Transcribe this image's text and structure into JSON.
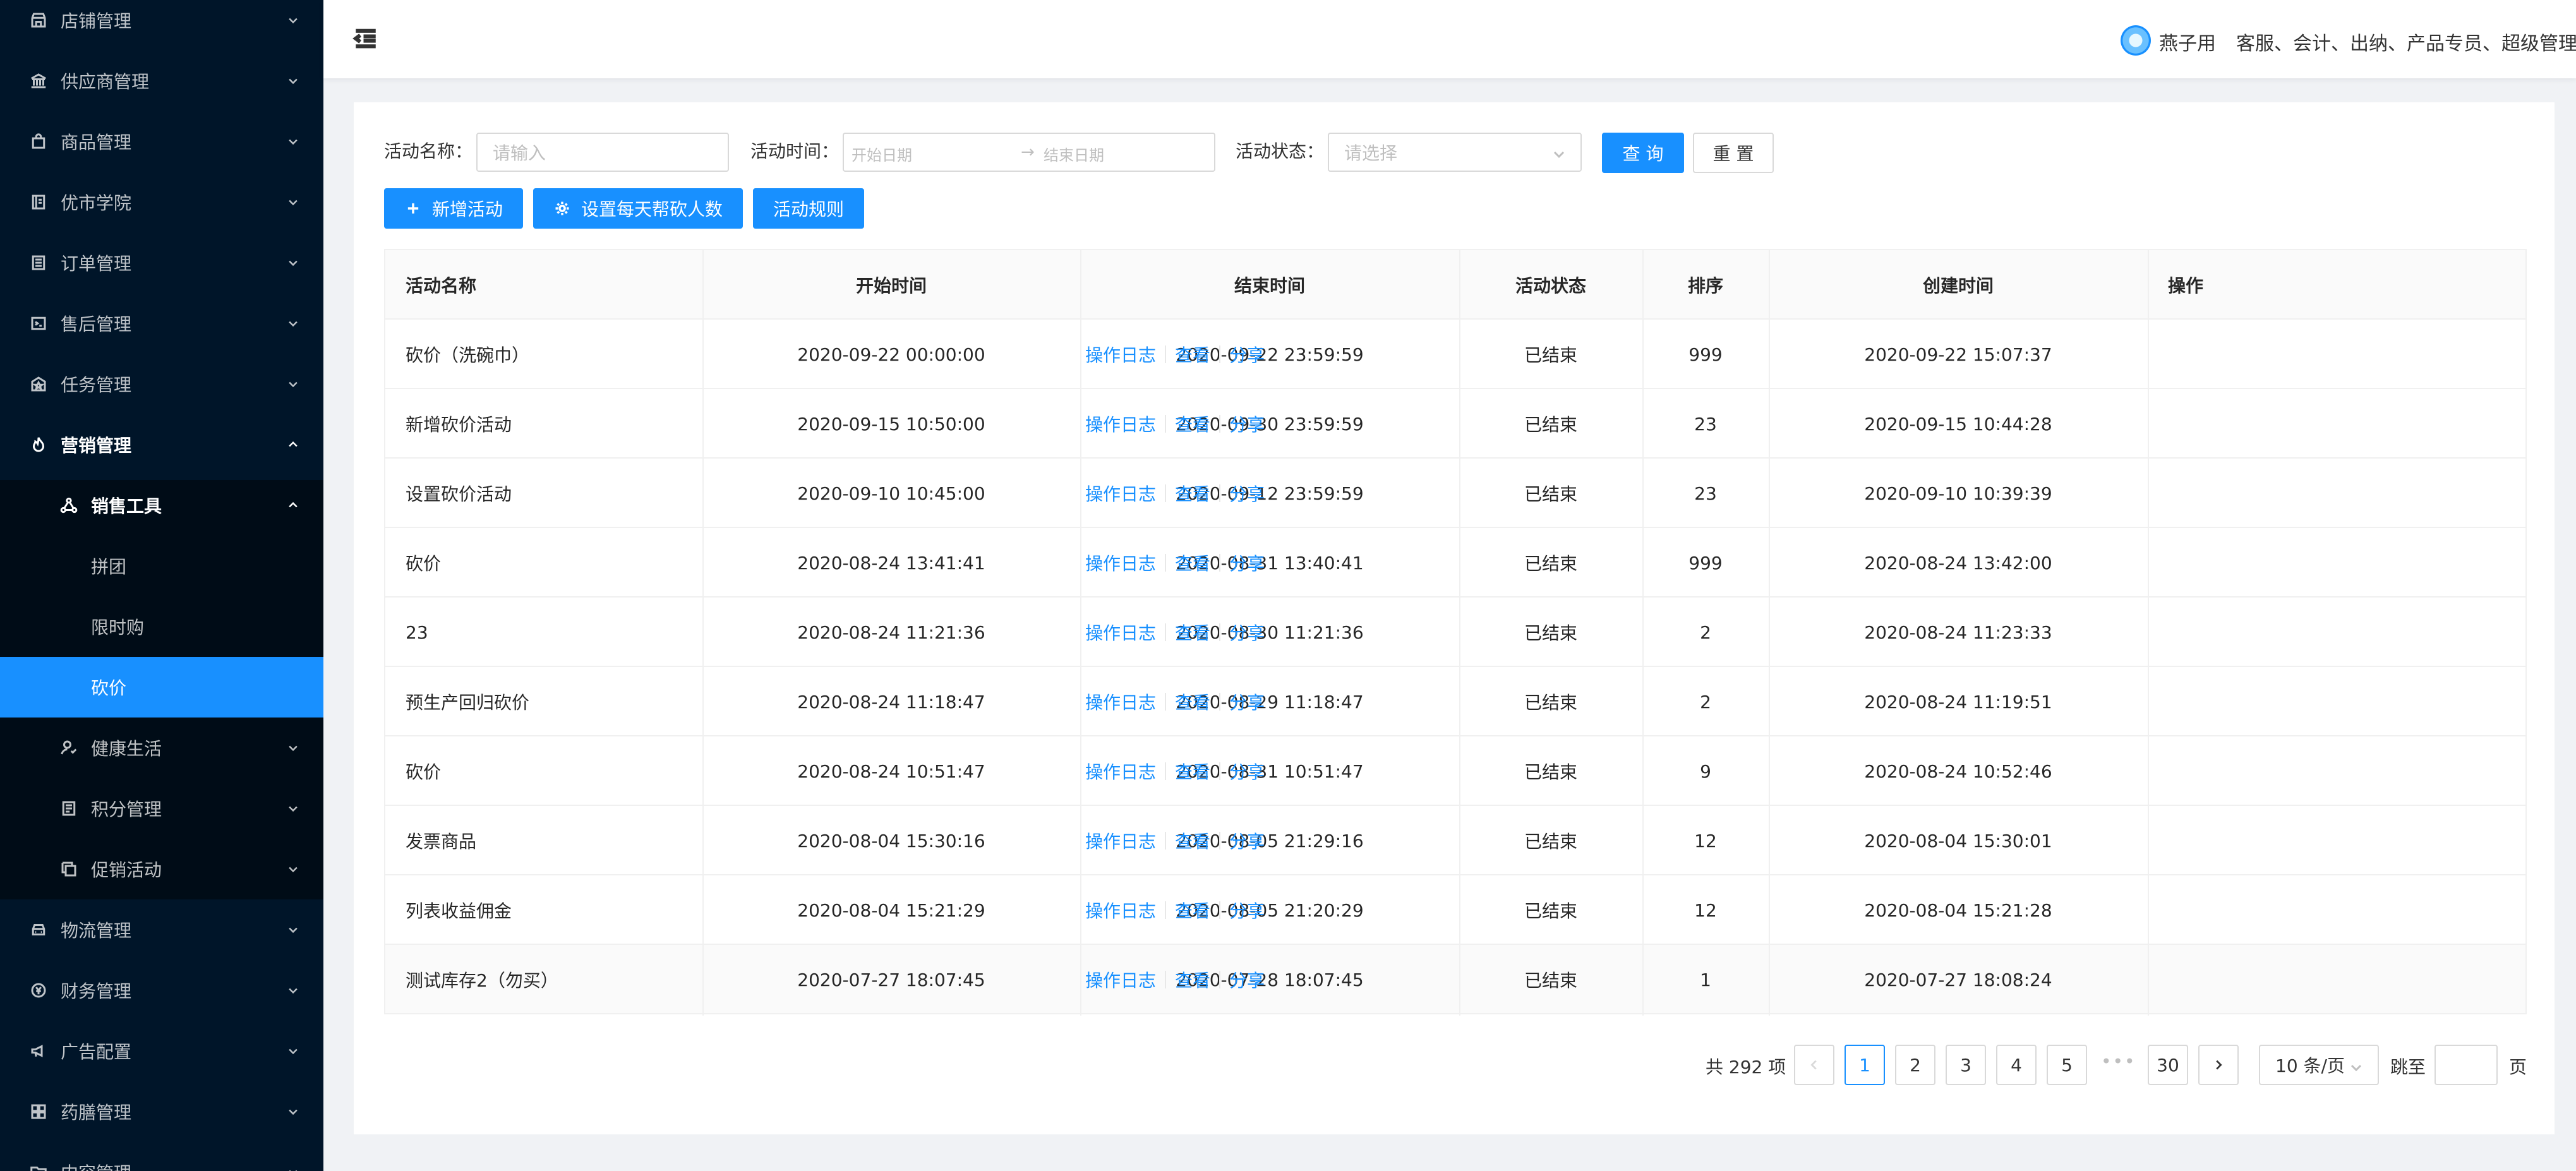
{
  "sidebar": {
    "items": [
      {
        "label": "店铺管理",
        "icon": "shop-icon"
      },
      {
        "label": "供应商管理",
        "icon": "bank-icon"
      },
      {
        "label": "商品管理",
        "icon": "shopping-bag-icon"
      },
      {
        "label": "优市学院",
        "icon": "book-icon"
      },
      {
        "label": "订单管理",
        "icon": "list-icon"
      },
      {
        "label": "售后管理",
        "icon": "terminal-icon"
      },
      {
        "label": "任务管理",
        "icon": "star-box-icon"
      },
      {
        "label": "营销管理",
        "icon": "fire-icon"
      },
      {
        "label": "物流管理",
        "icon": "car-icon"
      },
      {
        "label": "财务管理",
        "icon": "money-icon"
      },
      {
        "label": "广告配置",
        "icon": "megaphone-icon"
      },
      {
        "label": "药膳管理",
        "icon": "grid-icon"
      },
      {
        "label": "内容管理",
        "icon": "folder-icon"
      }
    ],
    "marketing_sub": {
      "sales_tools": {
        "label": "销售工具",
        "children": [
          "拼团",
          "限时购",
          "砍价"
        ]
      },
      "health": "健康生活",
      "points": "积分管理",
      "promotion": "促销活动"
    },
    "selected": "砍价"
  },
  "header": {
    "user_name": "燕子用",
    "user_roles": "客服、会计、出纳、产品专员、超级管理员"
  },
  "filters": {
    "name_label": "活动名称：",
    "name_placeholder": "请输入",
    "time_label": "活动时间：",
    "start_placeholder": "开始日期",
    "end_placeholder": "结束日期",
    "status_label": "活动状态：",
    "status_placeholder": "请选择",
    "query_button": "查 询",
    "reset_button": "重 置"
  },
  "actions": {
    "add": "新增活动",
    "set_daily": "设置每天帮砍人数",
    "rules": "活动规则"
  },
  "table": {
    "columns": [
      "活动名称",
      "开始时间",
      "结束时间",
      "活动状态",
      "排序",
      "创建时间",
      "操作"
    ],
    "op_labels": [
      "操作日志",
      "查看",
      "分享"
    ],
    "rows": [
      {
        "name": "砍价（洗碗巾）",
        "start": "2020-09-22 00:00:00",
        "end": "2020-09-22 23:59:59",
        "status": "已结束",
        "sort": "999",
        "created": "2020-09-22 15:07:37"
      },
      {
        "name": "新增砍价活动",
        "start": "2020-09-15 10:50:00",
        "end": "2020-09-30 23:59:59",
        "status": "已结束",
        "sort": "23",
        "created": "2020-09-15 10:44:28"
      },
      {
        "name": "设置砍价活动",
        "start": "2020-09-10 10:45:00",
        "end": "2020-09-12 23:59:59",
        "status": "已结束",
        "sort": "23",
        "created": "2020-09-10 10:39:39"
      },
      {
        "name": "砍价",
        "start": "2020-08-24 13:41:41",
        "end": "2020-08-31 13:40:41",
        "status": "已结束",
        "sort": "999",
        "created": "2020-08-24 13:42:00"
      },
      {
        "name": "23",
        "start": "2020-08-24 11:21:36",
        "end": "2020-08-30 11:21:36",
        "status": "已结束",
        "sort": "2",
        "created": "2020-08-24 11:23:33"
      },
      {
        "name": "预生产回归砍价",
        "start": "2020-08-24 11:18:47",
        "end": "2020-08-29 11:18:47",
        "status": "已结束",
        "sort": "2",
        "created": "2020-08-24 11:19:51"
      },
      {
        "name": "砍价",
        "start": "2020-08-24 10:51:47",
        "end": "2020-08-31 10:51:47",
        "status": "已结束",
        "sort": "9",
        "created": "2020-08-24 10:52:46"
      },
      {
        "name": "发票商品",
        "start": "2020-08-04 15:30:16",
        "end": "2020-08-05 21:29:16",
        "status": "已结束",
        "sort": "12",
        "created": "2020-08-04 15:30:01"
      },
      {
        "name": "列表收益佣金",
        "start": "2020-08-04 15:21:29",
        "end": "2020-08-05 21:20:29",
        "status": "已结束",
        "sort": "12",
        "created": "2020-08-04 15:21:28"
      },
      {
        "name": "测试库存2（勿买）",
        "start": "2020-07-27 18:07:45",
        "end": "2020-07-28 18:07:45",
        "status": "已结束",
        "sort": "1",
        "created": "2020-07-27 18:08:24"
      }
    ]
  },
  "pagination": {
    "total": "共 292 项",
    "pages": [
      "1",
      "2",
      "3",
      "4",
      "5"
    ],
    "ellipsis": "•••",
    "last_page": "30",
    "current": "1",
    "page_size": "10 条/页",
    "jump_label": "跳至",
    "page_suffix": "页"
  },
  "colors": {
    "sidebar_bg": "#001529",
    "submenu_bg": "#000c17",
    "primary": "#1890ff"
  }
}
